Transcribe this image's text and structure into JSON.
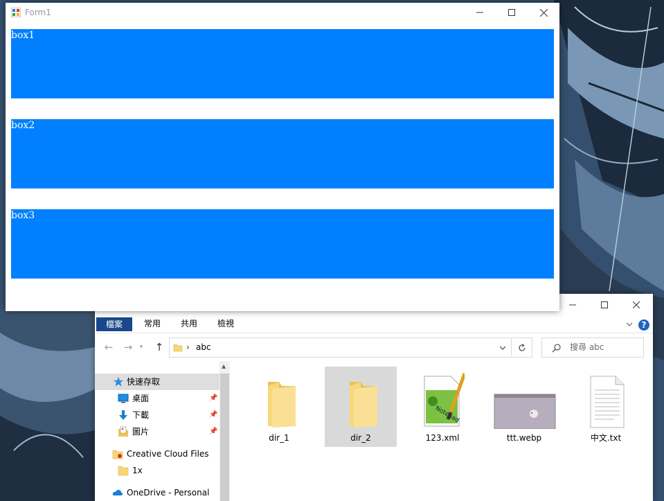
{
  "form": {
    "title": "Form1",
    "boxes": [
      {
        "label": "box1"
      },
      {
        "label": "box2"
      },
      {
        "label": "box3"
      }
    ],
    "box_color": "#0080FF"
  },
  "explorer": {
    "ribbon_tabs": [
      "檔案",
      "常用",
      "共用",
      "檢視"
    ],
    "address": {
      "path": "abc"
    },
    "search": {
      "placeholder": "搜尋 abc"
    },
    "nav": [
      {
        "label": "快速存取",
        "icon": "star-icon"
      },
      {
        "label": "桌面",
        "icon": "desktop-icon",
        "pinned": true
      },
      {
        "label": "下載",
        "icon": "download-icon",
        "pinned": true
      },
      {
        "label": "圖片",
        "icon": "pictures-icon",
        "pinned": true
      },
      {
        "label": "Creative Cloud Files",
        "icon": "creative-cloud-icon"
      },
      {
        "label": "1x",
        "icon": "folder-icon"
      },
      {
        "label": "OneDrive - Personal",
        "icon": "onedrive-icon"
      }
    ],
    "files": [
      {
        "name": "dir_1",
        "icon": "folder-icon"
      },
      {
        "name": "dir_2",
        "icon": "folder-icon",
        "selected": true
      },
      {
        "name": "123.xml",
        "icon": "notepadpp-icon"
      },
      {
        "name": "ttt.webp",
        "icon": "image-thumbnail-icon"
      },
      {
        "name": "中文.txt",
        "icon": "text-file-icon"
      }
    ]
  }
}
